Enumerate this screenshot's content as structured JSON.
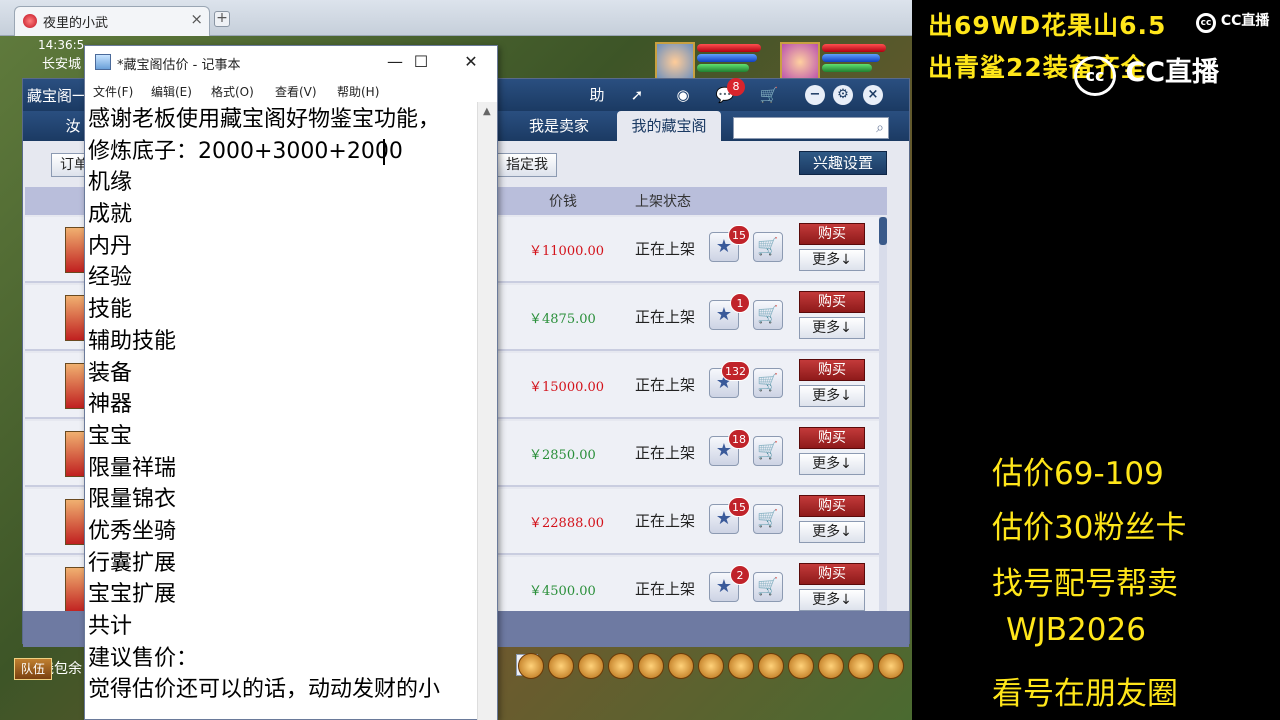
{
  "browser": {
    "tab_title": "夜里的小武",
    "tab_close": "×",
    "new_tab": "+"
  },
  "game": {
    "clock": "14:36:5",
    "location": "长安城",
    "team_button": "队伍",
    "wallet_label": "钱包余",
    "next_page": ">"
  },
  "treasure": {
    "window_title": "藏宝阁一",
    "help_label": "助",
    "chat_badge": "8",
    "tabs": [
      "我是卖家",
      "我的藏宝阁"
    ],
    "left_tab": "汝",
    "order_button": "订单",
    "assign_button": "指定我",
    "interest_button": "兴趣设置",
    "columns": {
      "price": "价钱",
      "status": "上架状态"
    },
    "buy_label": "购买",
    "more_label": "更多↓",
    "rows": [
      {
        "price": "￥11000.00",
        "price_color": "red",
        "status": "正在上架",
        "favs": "15"
      },
      {
        "price": "￥4875.00",
        "price_color": "green",
        "status": "正在上架",
        "favs": "1"
      },
      {
        "price": "￥15000.00",
        "price_color": "red",
        "status": "正在上架",
        "favs": "132"
      },
      {
        "price": "￥2850.00",
        "price_color": "green",
        "status": "正在上架",
        "favs": "18"
      },
      {
        "price": "￥22888.00",
        "price_color": "red",
        "status": "正在上架",
        "favs": "15"
      },
      {
        "price": "￥4500.00",
        "price_color": "green",
        "status": "正在上架",
        "favs": "2"
      }
    ]
  },
  "notepad": {
    "title": "*藏宝阁估价 - 记事本",
    "menu": [
      "文件(F)",
      "编辑(E)",
      "格式(O)",
      "查看(V)",
      "帮助(H)"
    ],
    "lines": [
      "感谢老板使用藏宝阁好物鉴宝功能，",
      "修炼底子：2000+3000+2000",
      "机缘",
      "成就",
      "内丹",
      "经验",
      "技能",
      "辅助技能",
      "装备",
      "神器",
      "宝宝",
      "限量祥瑞",
      "限量锦衣",
      "优秀坐骑",
      "行囊扩展",
      "宝宝扩展",
      "共计",
      "建议售价：",
      "觉得估价还可以的话，动动发财的小"
    ]
  },
  "overlay": {
    "top_lines": [
      "出69WD花果山6.5",
      "出青鲨22装备齐全"
    ],
    "cc_logo_small": "CC直播",
    "cc_logo_large": "CC直播",
    "info_lines": [
      "估价69-109",
      "估价30粉丝卡",
      "找号配号帮卖",
      "WJB2026",
      "看号在朋友圈"
    ]
  },
  "colors": {
    "overlay_text": "#ffe61a",
    "price_red": "#d3121a",
    "price_green": "#2a8f3a",
    "header_blue": "#1b3a63"
  }
}
